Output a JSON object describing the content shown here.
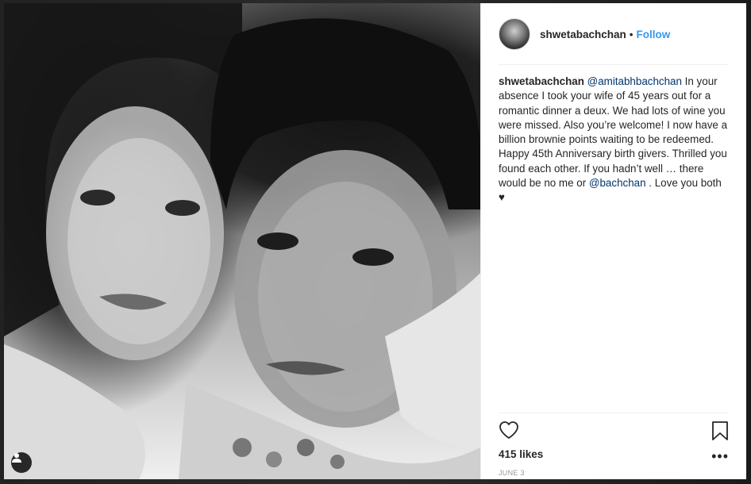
{
  "post": {
    "image_alt": "black and white couple photo",
    "user_tag_icon": "person-icon"
  },
  "header": {
    "username": "shwetabachchan",
    "separator": "•",
    "follow_label": "Follow"
  },
  "caption": {
    "username": "shwetabachchan",
    "mention_1": "@amitabhbachchan",
    "text_1": " In your absence I took your wife of 45 years out for a romantic dinner a deux. We had lots of wine you were missed. Also you’re welcome! I now have a billion brownie points waiting to be redeemed. Happy 45th Anniversary birth givers. Thrilled you found each other. If you hadn’t well … there would be no me or ",
    "mention_2": "@bachchan",
    "text_2": " . Love you both ♥"
  },
  "actions": {
    "like_icon": "heart-outline-icon",
    "save_icon": "bookmark-outline-icon",
    "more_label": "•••"
  },
  "stats": {
    "likes": "415 likes",
    "date": "JUNE 3"
  },
  "colors": {
    "link": "#3897f0",
    "mention": "#003569",
    "text": "#262626",
    "muted": "#999999"
  }
}
